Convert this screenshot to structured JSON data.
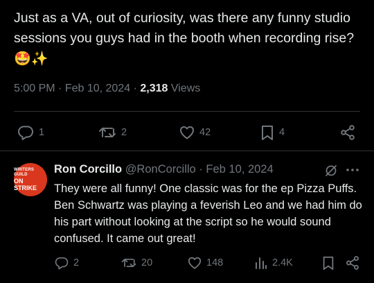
{
  "main_tweet": {
    "text": "Just as a VA, out of curiosity, was there any funny studio sessions you guys had in the booth when recording rise?",
    "emojis": "🤩✨",
    "time": "5:00 PM",
    "date": "Feb 10, 2024",
    "views_count": "2,318",
    "views_label": "Views",
    "actions": {
      "replies": "1",
      "reposts": "2",
      "likes": "42",
      "bookmarks": "4"
    }
  },
  "reply": {
    "avatar": {
      "line1": "WRITERS GUILD",
      "line2": "ON STRIKE"
    },
    "name": "Ron Corcillo",
    "handle": "@RonCorcillo",
    "date": "Feb 10, 2024",
    "text": "They were all funny! One classic was for the ep Pizza Puffs. Ben Schwartz was playing a feverish Leo and we had him do his part without looking at the script so he would sound confused. It came out great!",
    "actions": {
      "replies": "2",
      "reposts": "20",
      "likes": "148",
      "views": "2.4K"
    }
  },
  "colors": {
    "background": "#000000",
    "text": "#e7e9ea",
    "muted": "#71767b",
    "divider": "#2f3336",
    "avatar": "#d9381e"
  },
  "icons": [
    "reply-icon",
    "repost-icon",
    "like-icon",
    "bookmark-icon",
    "share-icon",
    "grok-icon",
    "more-icon",
    "views-icon"
  ]
}
